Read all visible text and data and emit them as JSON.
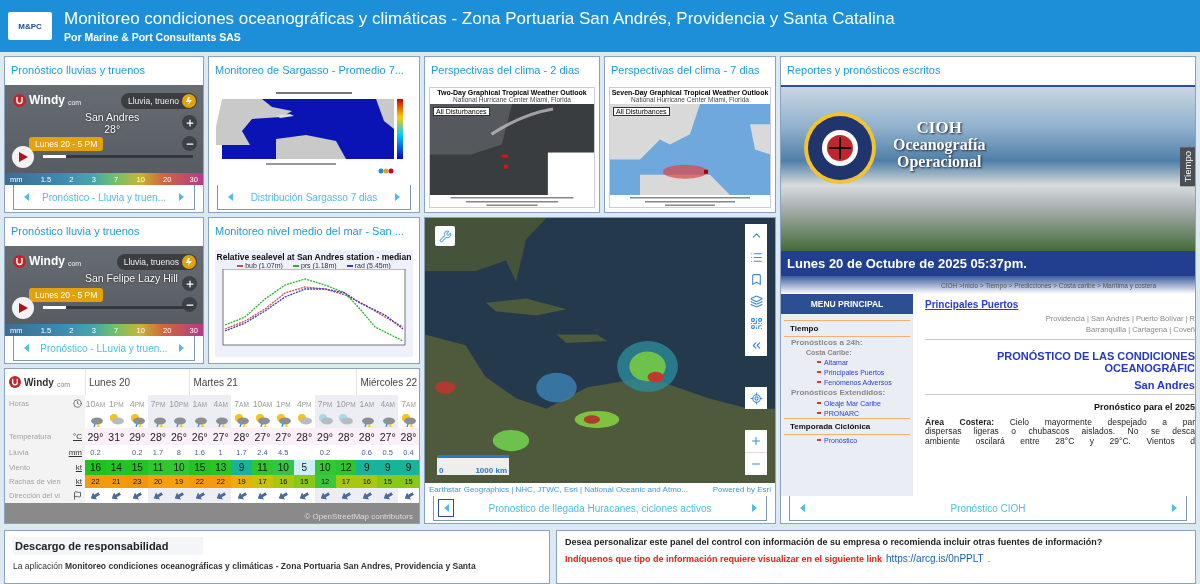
{
  "header": {
    "logo": "M&PC",
    "title": "Monitoreo condiciones oceanográficas y climáticas - Zona Portuaria San Andrés, Providencia y Santa Catalina",
    "subtitle": "Por Marine & Port Consultants SAS"
  },
  "windy_widgets": [
    {
      "title": "Pronóstico lluvias y truenos",
      "brand": "Windy",
      "brand_suffix": "com",
      "location": "San Andres",
      "temperature": "28°",
      "layer": "Lluvia, trueno",
      "time": "Lunes 20 - 5 PM",
      "level": 0.15,
      "legend_unit": "mm",
      "legend": [
        "1.5",
        "2",
        "3",
        "7",
        "10",
        "20",
        "30"
      ],
      "nav": "Pronóstico - Lluvia y truen..."
    },
    {
      "title": "Pronóstico lluvia y truenos",
      "brand": "Windy",
      "brand_suffix": "com",
      "location": "San Felipe Lazy Hill",
      "layer": "Lluvia, truenos",
      "time": "Lunes 20 - 5 PM",
      "level": 0.15,
      "legend_unit": "mm",
      "legend": [
        "1.5",
        "2",
        "3",
        "7",
        "10",
        "20",
        "30"
      ],
      "nav": "Pronóstico - LLuvia y truen..."
    }
  ],
  "sargasso": {
    "title": "Monitoreo de Sargasso - Promedio 7...",
    "nav": "Distribución Sargasso 7 dias"
  },
  "sea_level": {
    "title": "Monitoreo nivel medio del mar - San ...",
    "chart_title": "Relative sealevel at San Andres station - median",
    "series": [
      {
        "name": "bub (1.07m)",
        "color": "#d04848"
      },
      {
        "name": "prs (1.18m)",
        "color": "#22b822"
      },
      {
        "name": "rad (5.45m)",
        "color": "#3434c8"
      }
    ]
  },
  "outlooks": [
    {
      "title": "Perspectivas del clima - 2 dias",
      "kind": "satellite",
      "image_title": "Two-Day Graphical Tropical Weather Outlook",
      "image_subtitle": "National Hurricane Center  Miami, Florida",
      "tag": "All Disturbances"
    },
    {
      "title": "Perspectivas del clima - 7 dias",
      "kind": "outline",
      "image_title": "Seven-Day Graphical Tropical Weather Outlook",
      "image_subtitle": "National Hurricane Center  Miami, Florida",
      "tag": "All Disturbances"
    }
  ],
  "hurricane_map": {
    "scale_start": "0",
    "scale_end": "1000 km",
    "attribution": "Earthstar Geographics | NHC, JTWC, Esri | National Oceanic and Atmo...",
    "powered": "Powered by Esri",
    "nav": "Pronostico de llegada Huracanes, ciclones activos"
  },
  "forecast": {
    "brand": "Windy",
    "brand_suffix": "com",
    "attribution": "© OpenStreetMap contributors",
    "rows": [
      {
        "kind": "hours",
        "label": "Horas"
      },
      {
        "kind": "weather"
      },
      {
        "kind": "temp",
        "label": "Temperatura",
        "unit": "°C"
      },
      {
        "kind": "rain",
        "label": "Lluvia",
        "unit": "mm"
      },
      {
        "kind": "wind",
        "label": "Viento",
        "unit": "kt"
      },
      {
        "kind": "gust",
        "label": "Rachas de vien",
        "unit": "kt"
      },
      {
        "kind": "dir",
        "label": "Dirección del vi"
      }
    ],
    "days": [
      {
        "label": "Lunes 20",
        "hours": [
          {
            "hour": "10",
            "period": "AM",
            "night": false,
            "kind": "storm",
            "temp": "29°",
            "rain": "0.2",
            "wind": {
              "value": "16",
              "color": "#1fc31f"
            },
            "gust": {
              "value": "22",
              "color": "#f59a0c"
            }
          },
          {
            "hour": "1",
            "period": "PM",
            "night": false,
            "kind": "sun-cloud",
            "temp": "31°",
            "wind": {
              "value": "14",
              "color": "#25c425"
            },
            "gust": {
              "value": "21",
              "color": "#f59a0c"
            }
          },
          {
            "hour": "4",
            "period": "PM",
            "night": false,
            "kind": "sun-storm",
            "temp": "29°",
            "rain": "0.2",
            "wind": {
              "value": "15",
              "color": "#22c322"
            },
            "gust": {
              "value": "23",
              "color": "#f39512"
            }
          },
          {
            "hour": "7",
            "period": "PM",
            "night": true,
            "kind": "storm",
            "temp": "28°",
            "rain": "1.7",
            "wind": {
              "value": "11",
              "color": "#2ec82e"
            },
            "gust": {
              "value": "20",
              "color": "#f5a00c"
            }
          },
          {
            "hour": "10",
            "period": "PM",
            "night": true,
            "kind": "storm",
            "temp": "26°",
            "rain": "8",
            "wind": {
              "value": "10",
              "color": "#33c833"
            },
            "gust": {
              "value": "19",
              "color": "#f5a00c"
            }
          }
        ]
      },
      {
        "label": "Martes 21",
        "hours": [
          {
            "hour": "1",
            "period": "AM",
            "night": true,
            "kind": "storm",
            "temp": "26°",
            "rain": "1.6",
            "wind": {
              "value": "15",
              "color": "#22c322"
            },
            "gust": {
              "value": "22",
              "color": "#f59a0c"
            }
          },
          {
            "hour": "4",
            "period": "AM",
            "night": true,
            "kind": "storm",
            "temp": "27°",
            "rain": "1",
            "wind": {
              "value": "13",
              "color": "#28c428"
            },
            "gust": {
              "value": "22",
              "color": "#f59a0c"
            }
          },
          {
            "hour": "7",
            "period": "AM",
            "night": false,
            "kind": "sun-storm",
            "temp": "28°",
            "rain": "1.7",
            "wind": {
              "value": "9",
              "color": "#19b39a"
            },
            "gust": {
              "value": "19",
              "color": "#e8b00a"
            }
          },
          {
            "hour": "10",
            "period": "AM",
            "night": false,
            "kind": "sun-storm",
            "temp": "27°",
            "rain": "2.4",
            "wind": {
              "value": "11",
              "color": "#2ec82e"
            },
            "gust": {
              "value": "17",
              "color": "#c9c20a"
            }
          },
          {
            "hour": "1",
            "period": "PM",
            "night": false,
            "kind": "sun-storm",
            "temp": "27°",
            "rain": "4.5",
            "wind": {
              "value": "10",
              "color": "#35c44a"
            },
            "gust": {
              "value": "16",
              "color": "#a8c810"
            }
          },
          {
            "hour": "4",
            "period": "PM",
            "night": false,
            "kind": "sun-cloud",
            "temp": "28°",
            "wind": {
              "value": "5",
              "color": "#cfeef8"
            },
            "gust": {
              "value": "15",
              "color": "#88c818"
            }
          },
          {
            "hour": "7",
            "period": "PM",
            "night": true,
            "kind": "moon-cloud",
            "temp": "29°",
            "rain": "0.2",
            "wind": {
              "value": "10",
              "color": "#33c833"
            },
            "gust": {
              "value": "12",
              "color": "#3cc83c"
            }
          },
          {
            "hour": "10",
            "period": "PM",
            "night": true,
            "kind": "moon-cloud",
            "temp": "28°",
            "wind": {
              "value": "12",
              "color": "#2bc62b"
            },
            "gust": {
              "value": "17",
              "color": "#a8c810"
            }
          }
        ]
      },
      {
        "label": "Miércoles 22",
        "hours": [
          {
            "hour": "1",
            "period": "AM",
            "night": true,
            "kind": "storm",
            "temp": "28°",
            "rain": "0.6",
            "wind": {
              "value": "9",
              "color": "#19b39a"
            },
            "gust": {
              "value": "16",
              "color": "#a8c810"
            }
          },
          {
            "hour": "4",
            "period": "AM",
            "night": true,
            "kind": "storm",
            "temp": "27°",
            "rain": "0.5",
            "wind": {
              "value": "9",
              "color": "#19b39a"
            },
            "gust": {
              "value": "15",
              "color": "#88c818"
            }
          },
          {
            "hour": "7",
            "period": "AM",
            "night": false,
            "kind": "sun-storm",
            "temp": "28°",
            "rain": "0.4",
            "wind": {
              "value": "9",
              "color": "#19b39a"
            },
            "gust": {
              "value": "15",
              "color": "#88c818"
            }
          }
        ]
      }
    ]
  },
  "reports": {
    "title": "Reportes y pronósticos escritos",
    "banner_title": [
      "CIOH",
      "Oceanografía",
      "Operacional"
    ],
    "side_tab": "Tiempo",
    "date": "Lunes 20 de Octubre de 2025 05:37pm.",
    "breadcrumb": "CIOH >Inicio > Tiempo > Predicciones > Costa caribe > Marítima y costera",
    "menu_title": "MENU PRINCIPAL",
    "menu": [
      {
        "label": "Tiempo",
        "children": [
          {
            "label": "Pronósticos a 24h:",
            "children": [
              {
                "label": "Costa Caribe:",
                "children": [
                  {
                    "label": "Altamar"
                  },
                  {
                    "label": "Principales Puertos"
                  },
                  {
                    "label": "Fenómenos Adversos"
                  }
                ]
              }
            ]
          },
          {
            "label": "Pronósticos Extendidos:",
            "children": [
              {
                "label": "Oleaje Mar Caribe"
              },
              {
                "label": "PRONARC"
              }
            ]
          }
        ]
      },
      {
        "label": "Temporada Ciclónica",
        "children": [
          {
            "label": "Pronóstico"
          }
        ]
      }
    ],
    "ports_title": "Principales Puertos",
    "ports_lines": [
      "Providencia | San Andrés | Puerto Bolívar | R",
      "Barranquilla | Cartagena | Coveñ"
    ],
    "heading": [
      "PRONÓSTICO DE LAS CONDICIONES",
      "OCEANOGRÁFIC"
    ],
    "place": "San Andres",
    "forecast_date": "Pronóstico para el 2025",
    "paragraph": [
      "**Área Costera:** Cielo mayormente despejado a par",
      "dispersas ligeras o chubascos aislados. No se desca",
      "ambiente oscilará entre 28°C y 29°C. Vientos d"
    ],
    "nav": "Pronóstico CIOH"
  },
  "disclaimer": {
    "title": "Descargo de responsabilidad",
    "text": "La aplicación **Monitoreo condiciones oceanográficas y climáticas - Zona Portuaria San Andres, Providencia y Santa**"
  },
  "contact": {
    "question": "Desea personalizar este panel del control con información de su empresa o recomienda incluir otras fuentes de información?",
    "request": "Indíquenos que tipo de información requiere visualizar en el siguiente link",
    "link": "https://arcg.is/0nPPLT",
    "end": "."
  }
}
